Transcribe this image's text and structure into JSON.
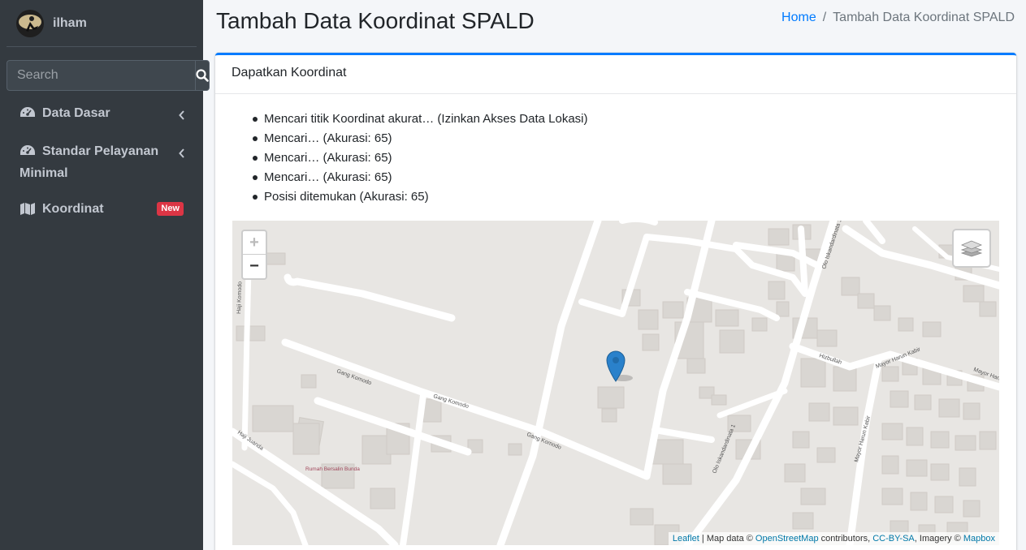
{
  "user": {
    "name": "ilham"
  },
  "search": {
    "placeholder": "Search"
  },
  "nav": {
    "items": [
      {
        "label": "Data Dasar"
      },
      {
        "label": "Standar Pelayanan Minimal"
      },
      {
        "label": "Koordinat",
        "badge": "New"
      }
    ]
  },
  "header": {
    "title": "Tambah Data Koordinat SPALD",
    "breadcrumb": {
      "home": "Home",
      "separator": "/",
      "current": "Tambah Data Koordinat SPALD"
    }
  },
  "card": {
    "title": "Dapatkan Koordinat",
    "status": [
      "Mencari titik Koordinat akurat… (Izinkan Akses Data Lokasi)",
      "Mencari… (Akurasi: 65)",
      "Mencari… (Akurasi: 65)",
      "Mencari… (Akurasi: 65)",
      "Posisi ditemukan (Akurasi: 65)"
    ]
  },
  "map": {
    "zoom_in": "+",
    "zoom_out": "−",
    "streets": [
      "Gang Komodo",
      "Gang Komodo",
      "Gang Komodo",
      "Haji Juanda",
      "Haji Komodo",
      "Olo Iskandardinata 1",
      "Olo Iskandardinata 1",
      "Hizbullah",
      "Mayor Harun Kabir",
      "Mayor Harun Kabir",
      "Mayor Haru",
      "Rumah Bersalin Bunda"
    ],
    "attribution": {
      "leaflet": "Leaflet",
      "sep": " | Map data © ",
      "osm": "OpenStreetMap",
      "contrib": " contributors, ",
      "license": "CC-BY-SA",
      "imagery": ", Imagery © ",
      "mapbox": "Mapbox"
    }
  },
  "colors": {
    "sidebar": "#343a40",
    "accent": "#007bff",
    "badge": "#dc3545",
    "map_bg": "#e8e6e3",
    "marker": "#2a81cb"
  }
}
